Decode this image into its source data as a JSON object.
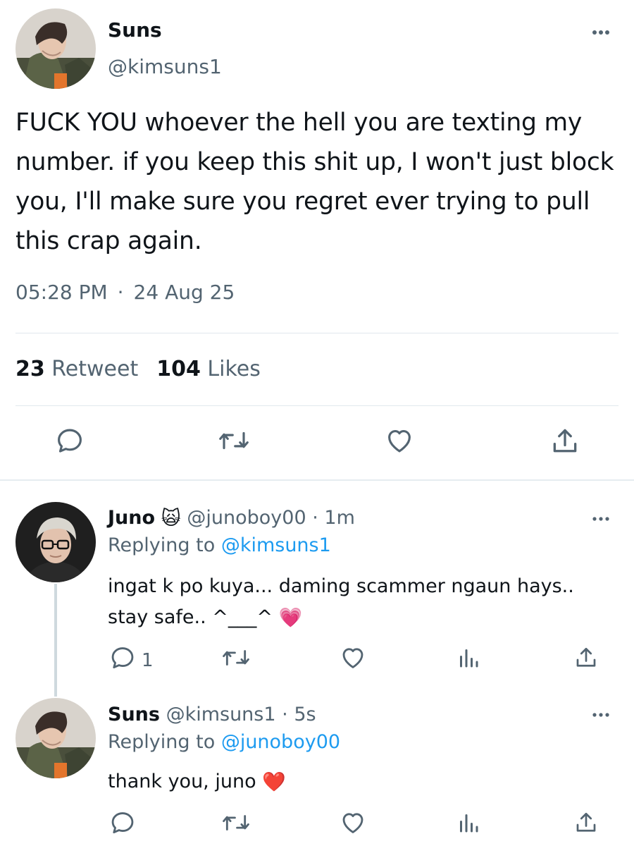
{
  "main_tweet": {
    "name": "Suns",
    "handle": "@kimsuns1",
    "text": "FUCK YOU whoever the hell you are texting my number. if you keep this shit up, I won't just block you, I'll make sure you regret ever trying to pull this crap again.",
    "time": "05:28 PM",
    "separator": "·",
    "date": "24 Aug 25",
    "retweet_count": "23",
    "retweet_label": "Retweet",
    "likes_count": "104",
    "likes_label": "Likes"
  },
  "replies": [
    {
      "name": "Juno",
      "name_emoji": "🙀",
      "handle": "@junoboy00",
      "time_sep": "·",
      "time": "1m",
      "replying_prefix": "Replying to",
      "replying_to": "@kimsuns1",
      "text": "ingat k po kuya... daming scammer ngaun hays.. stay safe.. ^___^",
      "text_emoji": "💗",
      "reply_count": "1"
    },
    {
      "name": "Suns",
      "handle": "@kimsuns1",
      "time_sep": "·",
      "time": "5s",
      "replying_prefix": "Replying to",
      "replying_to": "@junoboy00",
      "text": "thank you, juno",
      "text_emoji": "❤️"
    }
  ],
  "icons": {
    "reply": "reply-icon",
    "retweet": "retweet-icon",
    "like": "heart-icon",
    "share": "share-icon",
    "analytics": "analytics-icon",
    "more": "more-icon"
  },
  "colors": {
    "link": "#1d9bf0",
    "secondary_text": "#536471",
    "primary_text": "#0f1419"
  }
}
